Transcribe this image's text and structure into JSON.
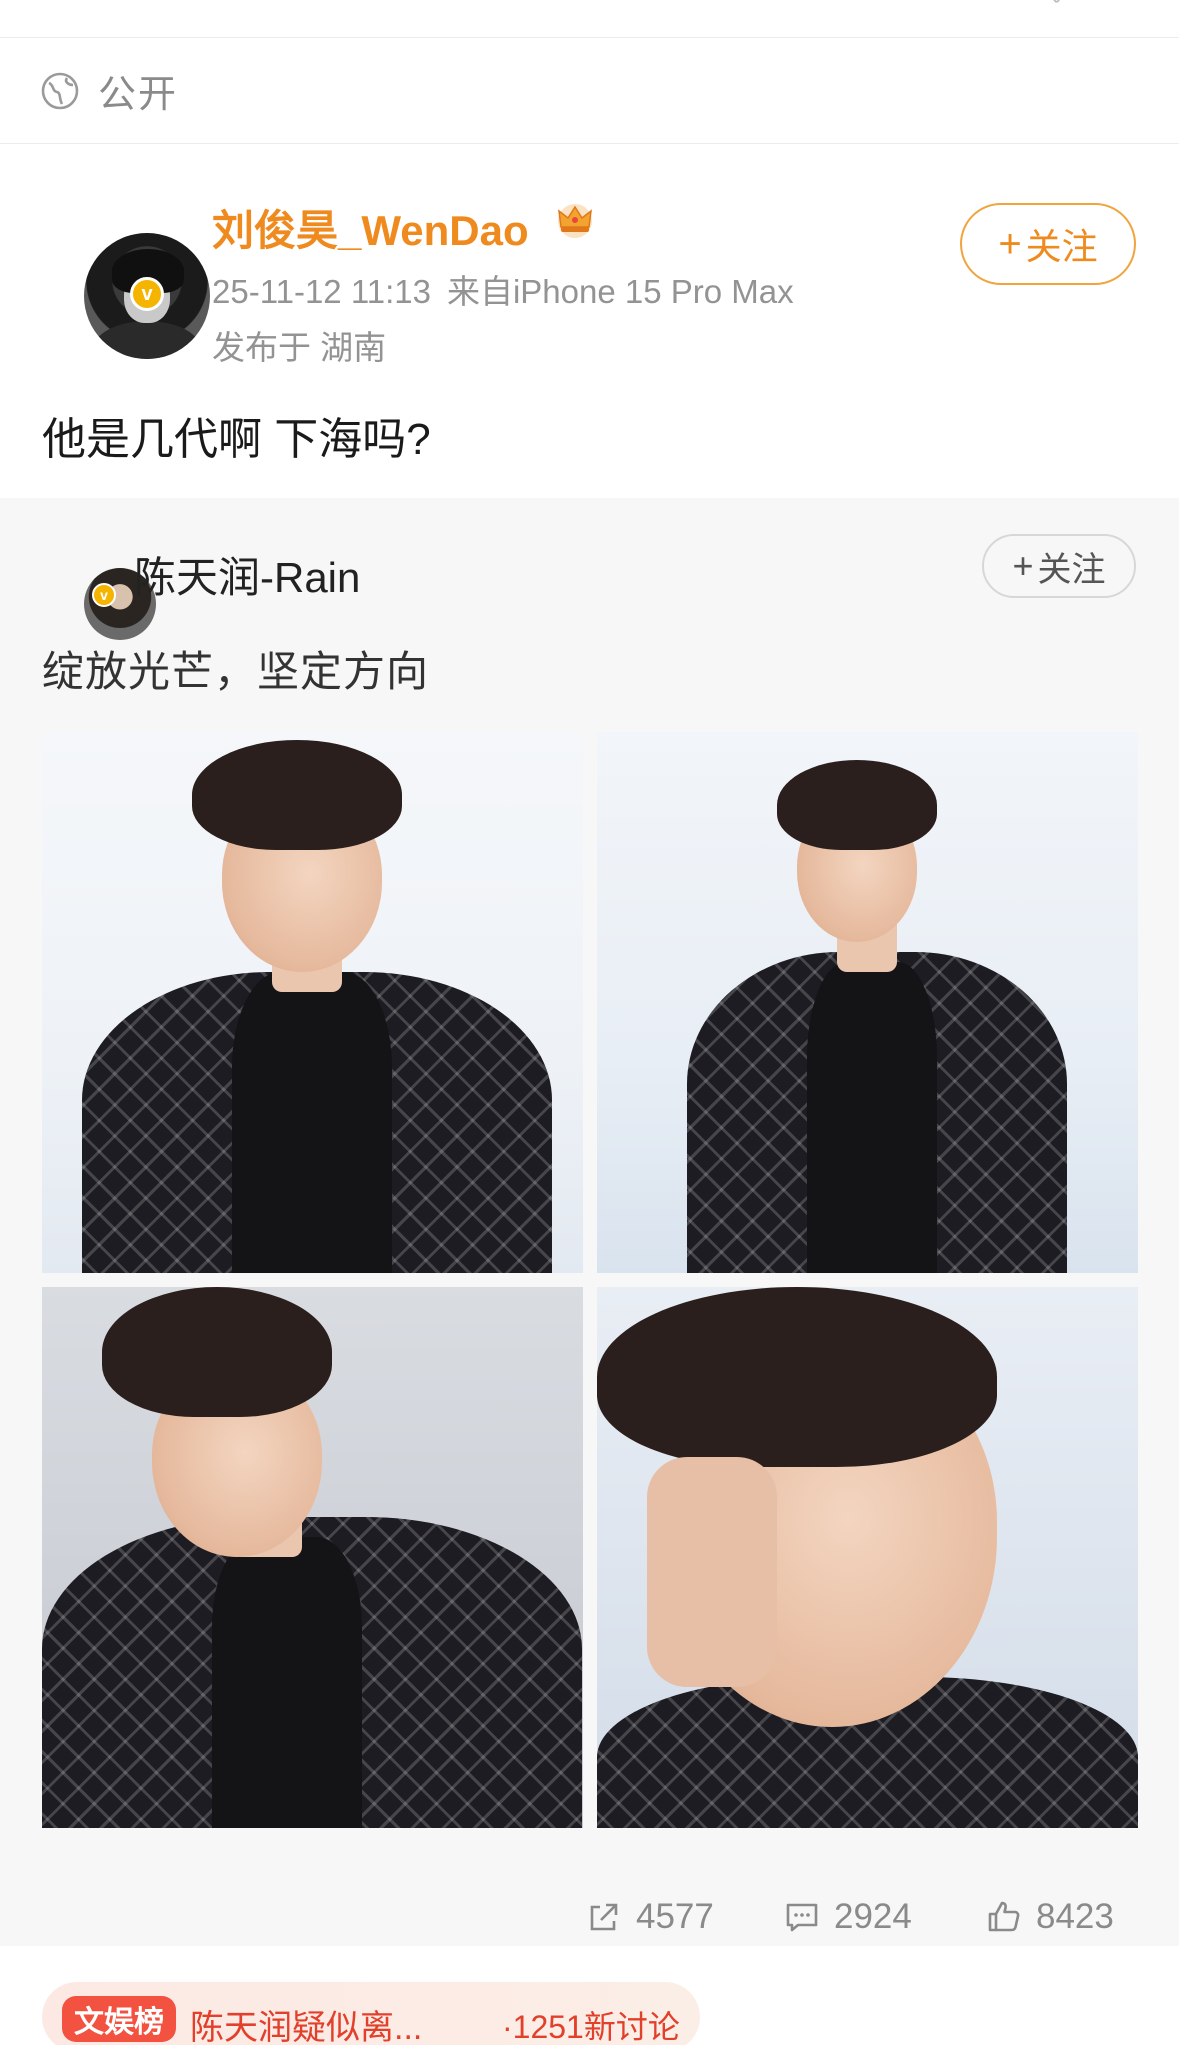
{
  "visibility": {
    "label": "公开",
    "icon": "globe-icon"
  },
  "post": {
    "author": "刘俊昊_WenDao",
    "author_color": "#ef8a1e",
    "badge": "crown-icon",
    "timestamp": "25-11-12 11:13",
    "source": "来自iPhone 15 Pro Max",
    "location": "发布于 湖南",
    "follow_label": "关注",
    "text": "他是几代啊 下海吗?"
  },
  "retweet": {
    "author": "陈天润-Rain",
    "follow_label": "关注",
    "text": "绽放光芒，坚定方向",
    "photos": [
      "photo-1",
      "photo-2",
      "photo-3",
      "photo-4"
    ]
  },
  "actions": {
    "repost": {
      "icon": "share-icon",
      "count": "4577"
    },
    "comment": {
      "icon": "comment-icon",
      "count": "2924"
    },
    "like": {
      "icon": "thumbs-up-icon",
      "count": "8423"
    }
  },
  "hot_topic": {
    "tag": "文娱榜",
    "title": "陈天润疑似离...",
    "count": "·1251新讨论"
  }
}
